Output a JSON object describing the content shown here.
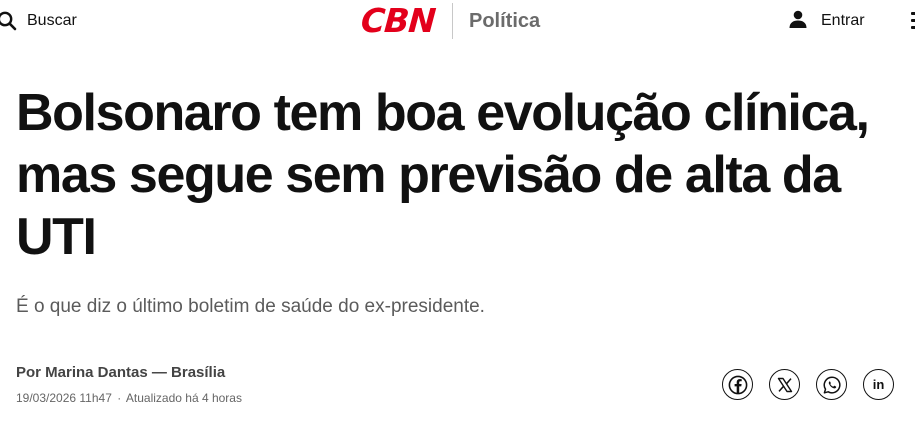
{
  "header": {
    "search_label": "Buscar",
    "logo_text": "CBN",
    "section_label": "Política",
    "login_label": "Entrar",
    "colors": {
      "brand": "#e3001b",
      "section": "#6b6b6b"
    }
  },
  "article": {
    "title": "Bolsonaro tem boa evolução clínica, mas segue sem previsão de alta da UTI",
    "subtitle": "É o que diz o último boletim de saúde do ex-presidente.",
    "byline": "Por Marina Dantas — Brasília",
    "published": "19/03/2026 11h47",
    "separator": "·",
    "updated": "Atualizado há 4 horas"
  },
  "share": {
    "buttons": [
      {
        "icon": "facebook-icon"
      },
      {
        "icon": "x-icon"
      },
      {
        "icon": "whatsapp-icon"
      },
      {
        "icon": "linkedin-icon",
        "text": "in"
      }
    ]
  }
}
